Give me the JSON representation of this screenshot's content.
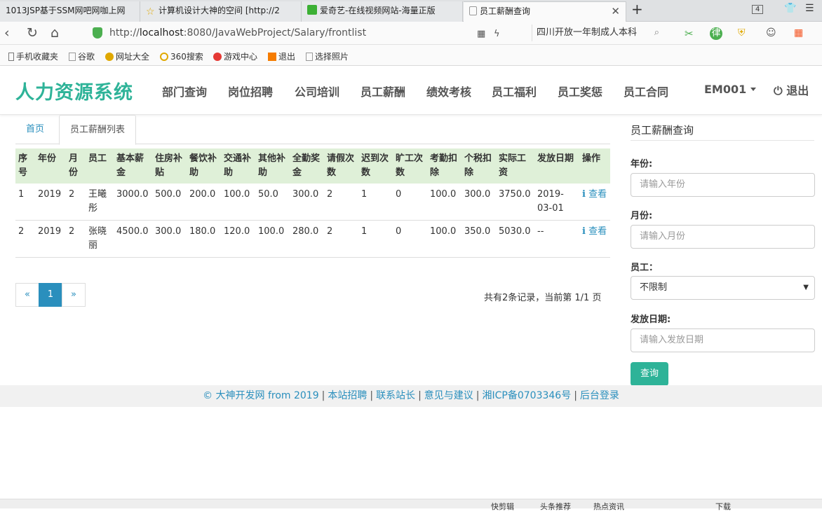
{
  "browser": {
    "tabs": [
      {
        "label": "1013JSP基于SSM网吧网咖上网"
      },
      {
        "label": "计算机设计大神的空间 [http://2"
      },
      {
        "label": "爱奇艺-在线视频网站-海量正版"
      },
      {
        "label": "员工薪酬查询"
      }
    ],
    "new_tab": "+",
    "tab_count": "4",
    "url_prefix": "http://",
    "url_host": "localhost",
    "url_rest": ":8080/JavaWebProject/Salary/frontlist",
    "search_text": "四川开放一年制成人本科",
    "bookmarks": [
      "手机收藏夹",
      "谷歌",
      "网址大全",
      "360搜索",
      "游戏中心",
      "退出",
      "选择照片"
    ]
  },
  "nav": {
    "brand": "人力资源系统",
    "menu": [
      "部门查询",
      "岗位招聘",
      "公司培训",
      "员工薪酬",
      "绩效考核",
      "员工福利",
      "员工奖惩",
      "员工合同"
    ],
    "user": "EM001",
    "logout": "退出"
  },
  "breadcrumb": {
    "home": "首页",
    "current": "员工薪酬列表"
  },
  "table": {
    "headers": [
      "序号",
      "年份",
      "月份",
      "员工",
      "基本薪金",
      "住房补贴",
      "餐饮补助",
      "交通补助",
      "其他补助",
      "全勤奖金",
      "请假次数",
      "迟到次数",
      "旷工次数",
      "考勤扣除",
      "个税扣除",
      "实际工资",
      "发放日期",
      "操作"
    ],
    "rows": [
      [
        "1",
        "2019",
        "2",
        "王曦彤",
        "3000.0",
        "500.0",
        "200.0",
        "100.0",
        "50.0",
        "300.0",
        "2",
        "1",
        "0",
        "100.0",
        "300.0",
        "3750.0",
        "2019-03-01"
      ],
      [
        "2",
        "2019",
        "2",
        "张晓丽",
        "4500.0",
        "300.0",
        "180.0",
        "120.0",
        "100.0",
        "280.0",
        "2",
        "1",
        "0",
        "100.0",
        "350.0",
        "5030.0",
        "--"
      ]
    ],
    "action_label": "查看"
  },
  "pagination": {
    "prev": "«",
    "current": "1",
    "next": "»",
    "info": "共有2条记录，当前第 1/1 页"
  },
  "sidebar": {
    "title": "员工薪酬查询",
    "year_label": "年份:",
    "year_placeholder": "请输入年份",
    "month_label": "月份:",
    "month_placeholder": "请输入月份",
    "employee_label": "员工：",
    "employee_value": "不限制",
    "date_label": "发放日期:",
    "date_placeholder": "请输入发放日期",
    "query_button": "查询"
  },
  "footer": {
    "items": [
      "© 大神开发网 from 2019",
      "本站招聘",
      "联系站长",
      "意见与建议",
      "湘ICP备0703346号",
      "后台登录"
    ]
  },
  "statusbar": {
    "items": [
      "快剪辑",
      "头条推荐",
      "热点资讯",
      "下载"
    ]
  },
  "colors": {
    "brand": "#2eb398",
    "link": "#2a8fbd",
    "table_header": "#dff0d8",
    "footer_bg": "#f1f1f1"
  }
}
